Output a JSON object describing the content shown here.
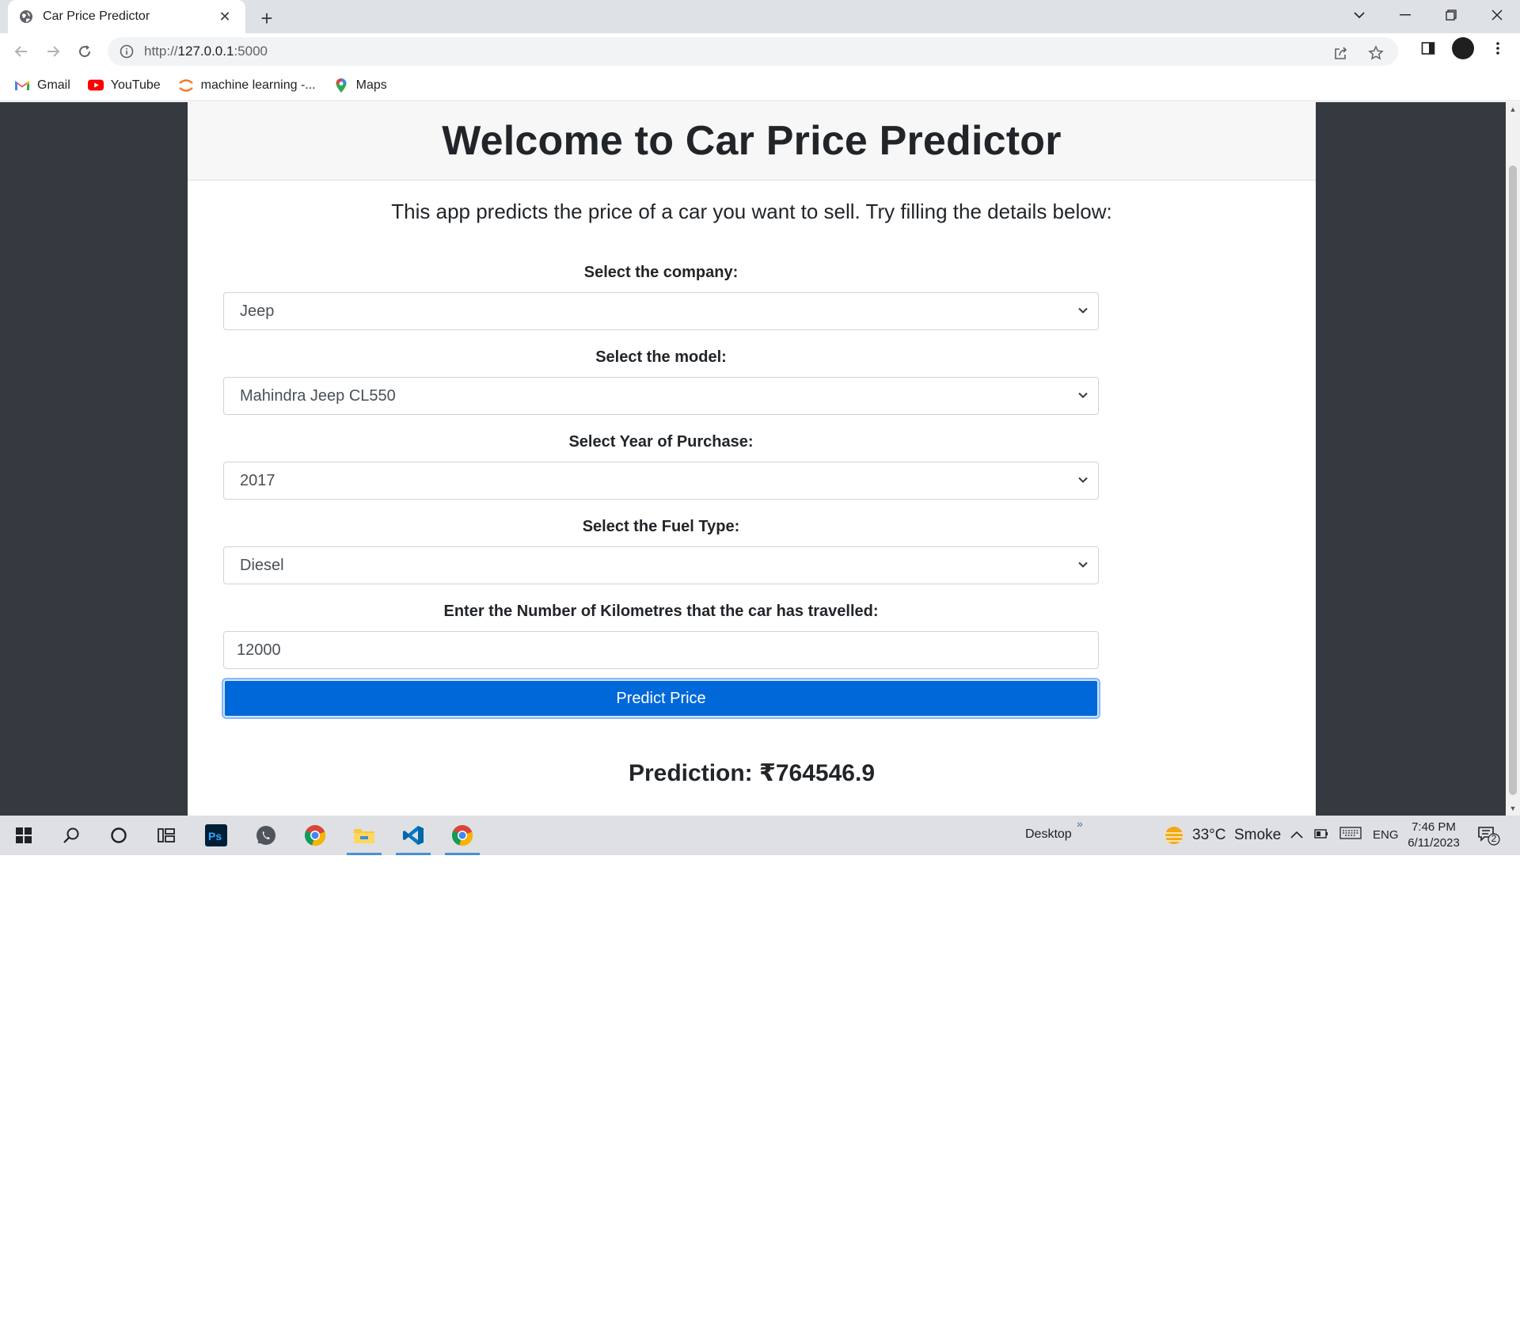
{
  "browser": {
    "tab_title": "Car Price Predictor",
    "url_scheme": "http://",
    "url_host": "127.0.0.1",
    "url_port": ":5000",
    "bookmarks": [
      "Gmail",
      "YouTube",
      "machine learning -...",
      "Maps"
    ]
  },
  "page": {
    "heading": "Welcome to Car Price Predictor",
    "intro": "This app predicts the price of a car you want to sell. Try filling the details below:",
    "fields": {
      "company": {
        "label": "Select the company:",
        "value": "Jeep"
      },
      "model": {
        "label": "Select the model:",
        "value": "Mahindra Jeep CL550"
      },
      "year": {
        "label": "Select Year of Purchase:",
        "value": "2017"
      },
      "fuel": {
        "label": "Select the Fuel Type:",
        "value": "Diesel"
      },
      "kms": {
        "label": "Enter the Number of Kilometres that the car has travelled:",
        "value": "12000"
      }
    },
    "button_label": "Predict Price",
    "prediction_text": "Prediction: ₹764546.9",
    "accent_color": "#0068d8",
    "background_color": "#343a40"
  },
  "taskbar": {
    "desktop_label": "Desktop",
    "weather": "33°C  Smoke",
    "language": "ENG",
    "time": "7:46 PM",
    "date": "6/11/2023",
    "notification_count": "2",
    "apps": [
      "start-icon",
      "search-icon",
      "cortana-icon",
      "task-view-icon",
      "photoshop-icon",
      "whatsapp-icon",
      "chrome-icon",
      "file-explorer-icon",
      "vscode-icon",
      "chrome-icon"
    ]
  }
}
